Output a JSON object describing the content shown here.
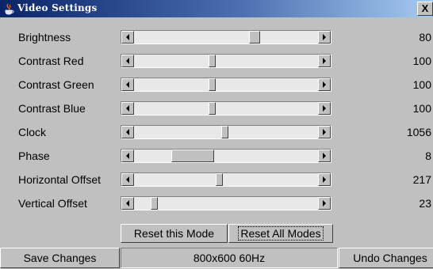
{
  "window": {
    "title": "Video Settings",
    "close_label": "X"
  },
  "sliders": [
    {
      "label": "Brightness",
      "value": "80",
      "thumb_position": 0.62,
      "thumb_size": 0.06
    },
    {
      "label": "Contrast Red",
      "value": "100",
      "thumb_position": 0.4,
      "thumb_size": 0.04
    },
    {
      "label": "Contrast Green",
      "value": "100",
      "thumb_position": 0.4,
      "thumb_size": 0.04
    },
    {
      "label": "Contrast Blue",
      "value": "100",
      "thumb_position": 0.4,
      "thumb_size": 0.04
    },
    {
      "label": "Clock",
      "value": "1056",
      "thumb_position": 0.47,
      "thumb_size": 0.04
    },
    {
      "label": "Phase",
      "value": "8",
      "thumb_position": 0.2,
      "thumb_size": 0.23
    },
    {
      "label": "Horizontal Offset",
      "value": "217",
      "thumb_position": 0.44,
      "thumb_size": 0.04
    },
    {
      "label": "Vertical Offset",
      "value": "23",
      "thumb_position": 0.09,
      "thumb_size": 0.04
    }
  ],
  "buttons": {
    "reset_mode": "Reset this Mode",
    "reset_all": "Reset All Modes",
    "save": "Save Changes",
    "undo": "Undo Changes"
  },
  "status": {
    "mode": "800x600 60Hz"
  }
}
